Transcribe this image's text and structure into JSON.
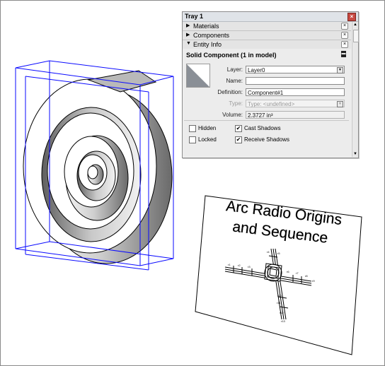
{
  "tray": {
    "title": "Tray 1",
    "close_glyph": "×",
    "sections": [
      {
        "label": "Materials",
        "expanded": false
      },
      {
        "label": "Components",
        "expanded": false
      },
      {
        "label": "Entity Info",
        "expanded": true
      }
    ],
    "entity_info": {
      "header": "Solid Component (1 in model)",
      "layer_label": "Layer:",
      "layer_value": "Layer0",
      "name_label": "Name:",
      "name_value": "",
      "definition_label": "Definition:",
      "definition_value": "Component#1",
      "type_label": "Type:",
      "type_value": "Type: <undefined>",
      "volume_label": "Volume:",
      "volume_value": "2.3727 in³",
      "hidden_label": "Hidden",
      "hidden_checked": false,
      "locked_label": "Locked",
      "locked_checked": false,
      "cast_label": "Cast Shadows",
      "cast_checked": true,
      "receive_label": "Receive Shadows",
      "receive_checked": true
    }
  },
  "paper": {
    "title_line1": "Arc Radio Origins",
    "title_line2": "and Sequence",
    "labels": [
      "r1",
      "r2",
      "r3",
      "r4",
      "r5",
      "r6",
      "r7",
      "r8",
      "r9",
      "r10",
      "r11",
      "r12",
      "r13"
    ]
  },
  "colors": {
    "bounding_box": "#0a0aff",
    "swatch_fill": "#8a8f96",
    "tray_title_bg": "#dfe3e8",
    "close_button": "#c84a42"
  },
  "icons": {
    "close": "close-icon",
    "collapsed": "triangle-right-icon",
    "expanded": "triangle-down-icon",
    "dropdown": "chevron-down-icon"
  }
}
